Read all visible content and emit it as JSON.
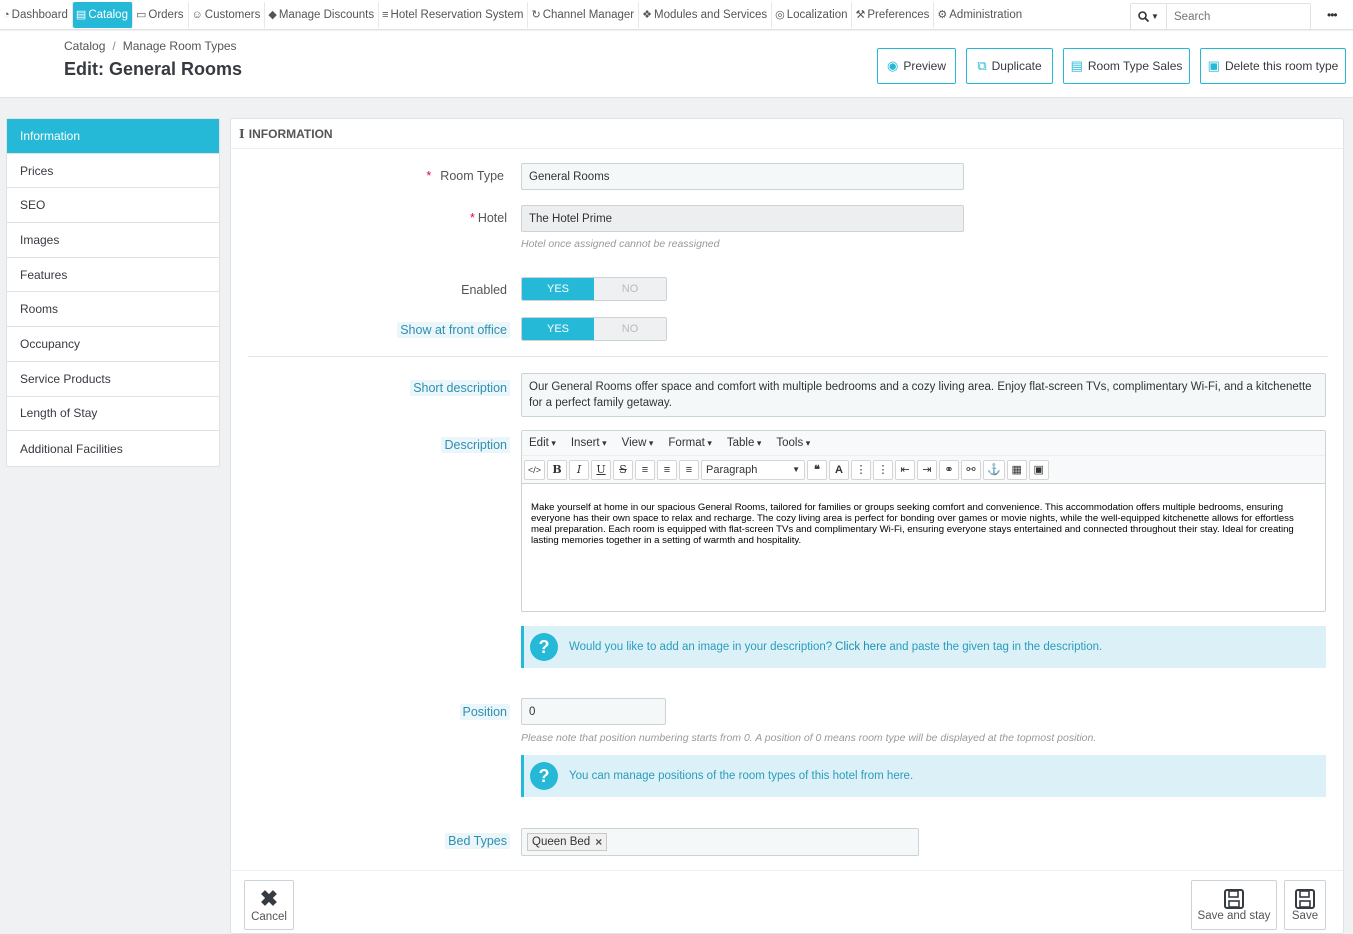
{
  "nav": {
    "items": [
      {
        "label": "Dashboard",
        "icon": "dashboard-icon",
        "glyph": "◔"
      },
      {
        "label": "Catalog",
        "icon": "book-icon",
        "glyph": "▤"
      },
      {
        "label": "Orders",
        "icon": "credit-card-icon",
        "glyph": "▭"
      },
      {
        "label": "Customers",
        "icon": "users-icon",
        "glyph": "☺"
      },
      {
        "label": "Manage Discounts",
        "icon": "tag-icon",
        "glyph": "◆"
      },
      {
        "label": "Hotel Reservation System",
        "icon": "bed-icon",
        "glyph": "≡"
      },
      {
        "label": "Channel Manager",
        "icon": "refresh-icon",
        "glyph": "↻"
      },
      {
        "label": "Modules and Services",
        "icon": "puzzle-icon",
        "glyph": "❖"
      },
      {
        "label": "Localization",
        "icon": "globe-icon",
        "glyph": "◎"
      },
      {
        "label": "Preferences",
        "icon": "wrench-icon",
        "glyph": "⚒"
      },
      {
        "label": "Administration",
        "icon": "cog-icon",
        "glyph": "⚙"
      }
    ],
    "search_placeholder": "Search",
    "more_label": "•••"
  },
  "header": {
    "breadcrumb": [
      "Catalog",
      "Manage Room Types"
    ],
    "breadcrumb_sep": "/",
    "title": "Edit: General Rooms",
    "buttons": {
      "preview": "Preview",
      "duplicate": "Duplicate",
      "sales": "Room Type Sales",
      "delete": "Delete this room type"
    }
  },
  "tabs": [
    "Information",
    "Prices",
    "SEO",
    "Images",
    "Features",
    "Rooms",
    "Occupancy",
    "Service Products",
    "Length of Stay",
    "Additional Facilities"
  ],
  "form": {
    "heading": "Information",
    "room_type_label": "Room Type",
    "room_type_value": "General Rooms",
    "hotel_label": "Hotel",
    "hotel_value": "The Hotel Prime",
    "hotel_help": "Hotel once assigned cannot be reassigned",
    "enabled_label": "Enabled",
    "show_front_label": "Show at front office",
    "yes": "YES",
    "no": "NO",
    "short_desc_label": "Short description",
    "short_desc_value": "Our General Rooms offer space and comfort with multiple bedrooms and a cozy living area. Enjoy flat-screen TVs, complimentary Wi-Fi, and a kitchenette for a perfect family getaway.",
    "desc_label": "Description",
    "editor_menu": [
      "Edit",
      "Insert",
      "View",
      "Format",
      "Table",
      "Tools"
    ],
    "editor_format_select": "Paragraph",
    "desc_value": "Make yourself at home in our spacious General Rooms, tailored for families or groups seeking comfort and convenience. This accommodation offers multiple bedrooms, ensuring everyone has their own space to relax and recharge. The cozy living area is perfect for bonding over games or movie nights, while the well-equipped kitchenette allows for effortless meal preparation. Each room is equipped with flat-screen TVs and complimentary Wi-Fi, ensuring everyone stays entertained and connected throughout their stay. Ideal for creating lasting memories together in a setting of warmth and hospitality.",
    "image_alert_pre": "Would you like to add an image in your description?",
    "image_alert_link": "Click here",
    "image_alert_post": "and paste the given tag in the description.",
    "position_label": "Position",
    "position_value": "0",
    "position_help": "Please note that position numbering starts from 0. A position of 0 means room type will be displayed at the topmost position.",
    "position_alert": "You can manage positions of the room types of this hotel from here.",
    "bed_types_label": "Bed Types",
    "bed_tag": "Queen Bed"
  },
  "footer": {
    "cancel": "Cancel",
    "save_stay": "Save and stay",
    "save": "Save"
  },
  "colors": {
    "accent": "#25b9d7",
    "required": "#e6005c"
  }
}
